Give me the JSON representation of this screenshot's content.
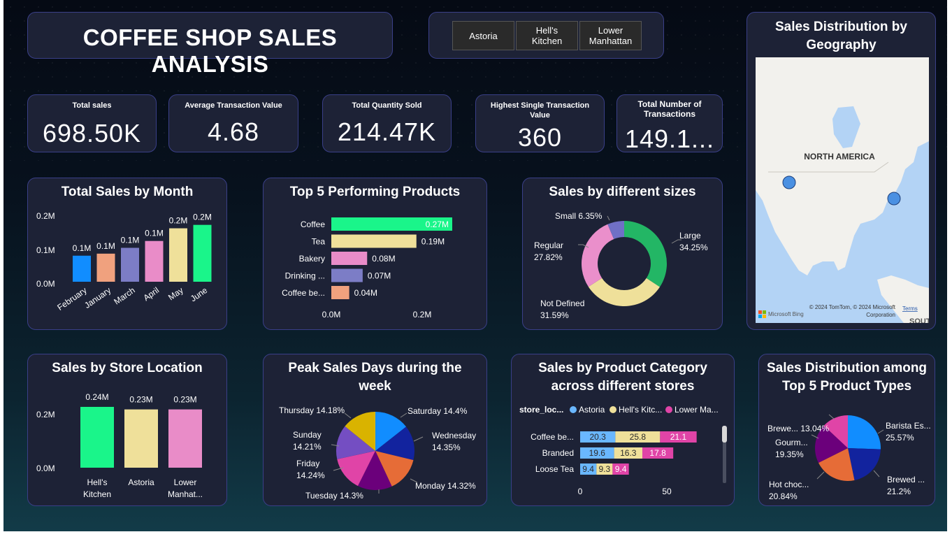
{
  "title": "COFFEE SHOP SALES ANALYSIS",
  "slicer": {
    "items": [
      "Astoria",
      "Hell's\nKitchen",
      "Lower\nManhattan"
    ]
  },
  "kpis": [
    {
      "label": "Total sales",
      "value": "698.50K"
    },
    {
      "label": "Average Transaction Value",
      "value": "4.68"
    },
    {
      "label": "Total Quantity Sold",
      "value": "214.47K"
    },
    {
      "label": "Highest Single Transaction Value",
      "value": "360"
    },
    {
      "label": "Total Number of Transactions",
      "value": "149.1..."
    }
  ],
  "map": {
    "title": "Sales Distribution by Geography",
    "region_label": "NORTH AMERICA",
    "corner_label": "SOUT",
    "attribution": "© 2024 TomTom, © 2024 Microsoft Corporation",
    "terms": "Terms",
    "bing": "Microsoft Bing",
    "land_color": "#f2f1ed",
    "water_color": "#b3d3f5",
    "bubble_color": "#4a90e2"
  },
  "colors": {
    "green": "#1af58a",
    "salmon": "#f0a17e",
    "slate": "#7c7dc6",
    "pink": "#e98cc8",
    "khaki": "#efe09a",
    "blue": "#118dff",
    "navy": "#12239e",
    "orange": "#e66c37",
    "purple": "#6b007b",
    "magenta": "#e044a7",
    "violet": "#744ec2",
    "gold": "#d9b300",
    "donut_green": "#23b665",
    "donut_khaki": "#efe09a",
    "donut_pink": "#ea8fcb",
    "donut_slate": "#7070c6",
    "astoria": "#6ab7ff",
    "hells": "#efe09a",
    "lower": "#e044a7"
  },
  "chart_data": [
    {
      "type": "bar",
      "title": "Total Sales by Month",
      "categories": [
        "February",
        "January",
        "March",
        "April",
        "May",
        "June"
      ],
      "values": [
        0.076,
        0.082,
        0.099,
        0.119,
        0.156,
        0.166
      ],
      "data_labels": [
        "0.1M",
        "0.1M",
        "0.1M",
        "0.1M",
        "0.2M",
        "0.2M"
      ],
      "y_ticks": [
        "0.2M",
        "0.1M",
        "0.0M"
      ],
      "ylim": [
        0,
        0.2
      ]
    },
    {
      "type": "bar",
      "title": "Top 5 Performing Products",
      "orientation": "horizontal",
      "categories": [
        "Coffee",
        "Tea",
        "Bakery",
        "Drinking ...",
        "Coffee be..."
      ],
      "values": [
        0.27,
        0.19,
        0.08,
        0.07,
        0.04
      ],
      "data_labels": [
        "0.27M",
        "0.19M",
        "0.08M",
        "0.07M",
        "0.04M"
      ],
      "x_ticks": [
        "0.0M",
        "0.2M"
      ],
      "xlim": [
        0,
        0.3
      ]
    },
    {
      "type": "pie",
      "title": "Sales by different sizes",
      "donut": true,
      "labels": [
        "Large",
        "Not Defined",
        "Regular",
        "Small"
      ],
      "values": [
        34.25,
        31.59,
        27.82,
        6.35
      ],
      "label_text": [
        "Large\n34.25%",
        "Not Defined\n31.59%",
        "Regular\n27.82%",
        "Small 6.35%"
      ]
    },
    {
      "type": "bar",
      "title": "Sales by Store Location",
      "categories": [
        "Hell's Kitchen",
        "Astoria",
        "Lower Manhat..."
      ],
      "category_labels": [
        "Hell's\nKitchen",
        "Astoria",
        "Lower\nManhat..."
      ],
      "values": [
        0.24,
        0.23,
        0.23
      ],
      "data_labels": [
        "0.24M",
        "0.23M",
        "0.23M"
      ],
      "y_ticks": [
        "0.2M",
        "0.0M"
      ],
      "ylim": [
        0,
        0.27
      ]
    },
    {
      "type": "pie",
      "title": "Peak Sales Days during the week",
      "labels": [
        "Saturday",
        "Wednesday",
        "Monday",
        "Tuesday",
        "Friday",
        "Sunday",
        "Thursday"
      ],
      "values": [
        14.4,
        14.35,
        14.32,
        14.3,
        14.24,
        14.21,
        14.18
      ],
      "label_text": [
        "Saturday 14.4%",
        "Wednesday\n14.35%",
        "Monday 14.32%",
        "Tuesday 14.3%",
        "Friday\n14.24%",
        "Sunday\n14.21%",
        "Thursday 14.18%"
      ]
    },
    {
      "type": "bar",
      "title": "Sales by Product Category across different stores",
      "orientation": "horizontal",
      "stacked": true,
      "legend_title": "store_loc...",
      "legend": [
        "Astoria",
        "Hell's Kitc...",
        "Lower Ma..."
      ],
      "categories": [
        "Coffee be...",
        "Branded",
        "Loose Tea"
      ],
      "series": [
        {
          "name": "Astoria",
          "values": [
            20.3,
            19.6,
            9.4
          ]
        },
        {
          "name": "Hell's Kitchen",
          "values": [
            25.8,
            16.3,
            9.3
          ]
        },
        {
          "name": "Lower Manhattan",
          "values": [
            21.1,
            17.8,
            9.4
          ]
        }
      ],
      "x_ticks": [
        "0",
        "50"
      ],
      "xlim": [
        0,
        75
      ]
    },
    {
      "type": "pie",
      "title": "Sales Distribution among Top 5 Product Types",
      "labels": [
        "Barista Es...",
        "Brewed ...",
        "Hot choc...",
        "Gourm...",
        "Brewe..."
      ],
      "values": [
        25.57,
        21.2,
        20.84,
        19.35,
        13.04
      ],
      "label_text": [
        "Barista Es...\n25.57%",
        "Brewed ...\n21.2%",
        "Hot choc...\n20.84%",
        "Gourm...\n19.35%",
        "Brewe... 13.04%"
      ]
    }
  ]
}
